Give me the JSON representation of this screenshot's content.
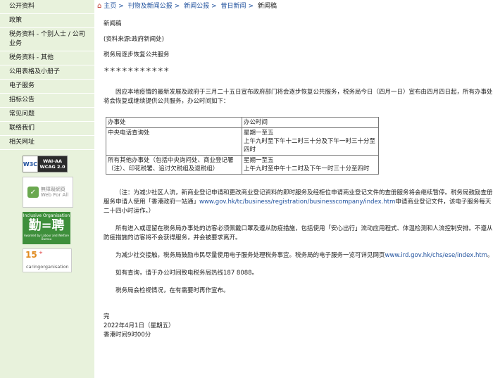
{
  "sidebar": {
    "items": [
      "公开资料",
      "政策",
      "税务资料 - 个别人士 / 公司业务",
      "税务资料 - 其他",
      "公用表格及小册子",
      "电子服务",
      "招标公告",
      "常见问题",
      "联络我们",
      "相关网址"
    ],
    "badges": {
      "wcag_left": "W3C",
      "wcag_right_1": "WAI-AA",
      "wcag_right_2": "WCAG 2.0",
      "webforall_1": "無障礙網頁",
      "webforall_2": "Web For All",
      "inclusive_title": "Inclusive Organisation",
      "inclusive_chars": "勤=聘",
      "inclusive_sub": "Awarded by Labour and Welfare Bureau",
      "caring_num": "15",
      "caring_plus": "+",
      "caring_word": "caringorganisation"
    }
  },
  "breadcrumb": [
    "主页",
    "刊物及新闻公报",
    "新闻公报",
    "昔日新闻",
    "新闻稿"
  ],
  "content": {
    "heading": "新闻稿",
    "source": "(资料来源:政府新闻处)",
    "title": "税务局逐步恢复公共服务",
    "stars": "＊＊＊＊＊＊＊＊＊＊＊",
    "para1": "因应本地疫情的最新发展及政府于三月二十五日宣布政府部门将会逐步恢复公共服务，税务局今日（四月一日）宣布由四月四日起，所有办事处将会恢复或继续提供公共服务，办公时间如下：",
    "table": {
      "header": [
        "办事处",
        "办公时间"
      ],
      "rows": [
        {
          "office": "中央电话查询处",
          "hours1": "星期一至五",
          "hours2": "上午九时至下午十二时三十分及下午一时三十分至四时"
        },
        {
          "office": "所有其他办事处（包括中央询问处、商业登记署（注）、印花税署、追讨欠税组及退税组）",
          "hours1": "星期一至五",
          "hours2": "上午九时至中午十二时及下午一时三十分至四时"
        }
      ]
    },
    "note_a": "（注：为减少社区人流，新商业登记申请和更改商业登记资料的即时服务及经柜位申请商业登记文件的查册服务将会继续暂停。税务局鼓励查册服务申请人使用「香港政府一站通」",
    "note_link": "www.gov.hk/tc/business/registration/businesscompany/index.htm",
    "note_b": "申请商业登记文件，该电子服务每天二十四小时运作。）",
    "para2": "所有进入或逗留在税务局办事处的访客必须佩戴口罩及遵从防疫措施，包括使用「安心出行」流动应用程式、体温检测和人流控制安排。不遵从防疫措施的访客将不会获得服务，并会被要求离开。",
    "para3": "为减少社交接触，税务局鼓励市民尽量使用电子服务处理税务事宜。税务局的电子服务一览可详见网页",
    "para3_link": "www.ird.gov.hk/chs/ese/index.htm",
    "para3_end": "。",
    "para4": "如有查询，请于办公时间致电税务局热线187 8088。",
    "para5": "税务局会检视情况，在有需要时再作宣布。",
    "end": "完",
    "date": "2022年4月1日（星期五）",
    "time": "香港时间9时00分"
  }
}
